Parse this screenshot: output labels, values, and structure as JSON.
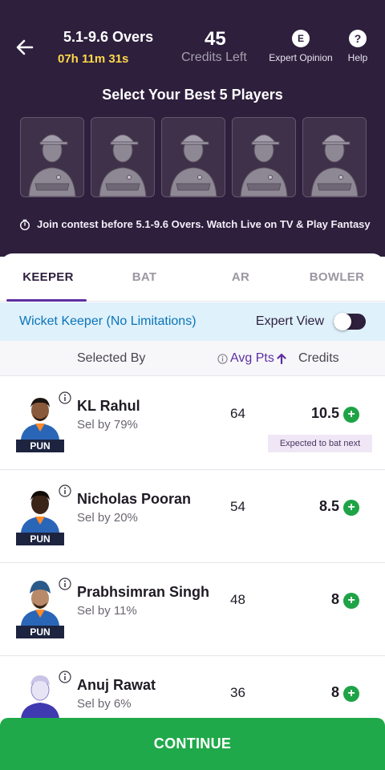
{
  "header": {
    "over_range": "5.1-9.6 Overs",
    "timer": "07h 11m 31s",
    "credits_left_value": "45",
    "credits_left_label": "Credits Left",
    "expert_opinion_icon": "E",
    "expert_opinion_label": "Expert Opinion",
    "help_icon": "?",
    "help_label": "Help"
  },
  "select_title": "Select Your Best 5 Players",
  "join_text": "Join contest before 5.1-9.6 Overs. Watch Live on TV & Play Fantasy",
  "tabs": [
    {
      "label": "KEEPER",
      "active": true
    },
    {
      "label": "BAT",
      "active": false
    },
    {
      "label": "AR",
      "active": false
    },
    {
      "label": "BOWLER",
      "active": false
    }
  ],
  "banner": {
    "text": "Wicket Keeper (No Limitations)",
    "expert_view_label": "Expert View",
    "expert_view_on": false
  },
  "columns": {
    "selected_by": "Selected By",
    "avg_pts": "Avg Pts",
    "credits": "Credits"
  },
  "players": [
    {
      "name": "KL Rahul",
      "sel": "Sel by 79%",
      "avg": "64",
      "credits": "10.5",
      "team": "PUN",
      "tag": "Expected to bat next",
      "skin": "#8a5a3c"
    },
    {
      "name": "Nicholas Pooran",
      "sel": "Sel by 20%",
      "avg": "54",
      "credits": "8.5",
      "team": "PUN",
      "tag": "",
      "skin": "#3b2418"
    },
    {
      "name": "Prabhsimran Singh",
      "sel": "Sel by 11%",
      "avg": "48",
      "credits": "8",
      "team": "PUN",
      "tag": "",
      "skin": "#b88a6a"
    },
    {
      "name": "Anuj Rawat",
      "sel": "Sel by 6%",
      "avg": "36",
      "credits": "8",
      "team": "",
      "tag": "",
      "skin": "#c9c3e6"
    }
  ],
  "add_icon": "+",
  "continue_label": "CONTINUE",
  "colors": {
    "header_bg": "#2e1f3d",
    "accent": "#5d2fa2",
    "timer": "#ffd84a",
    "banner_text": "#0a74b8",
    "continue_bg": "#20a94a"
  }
}
